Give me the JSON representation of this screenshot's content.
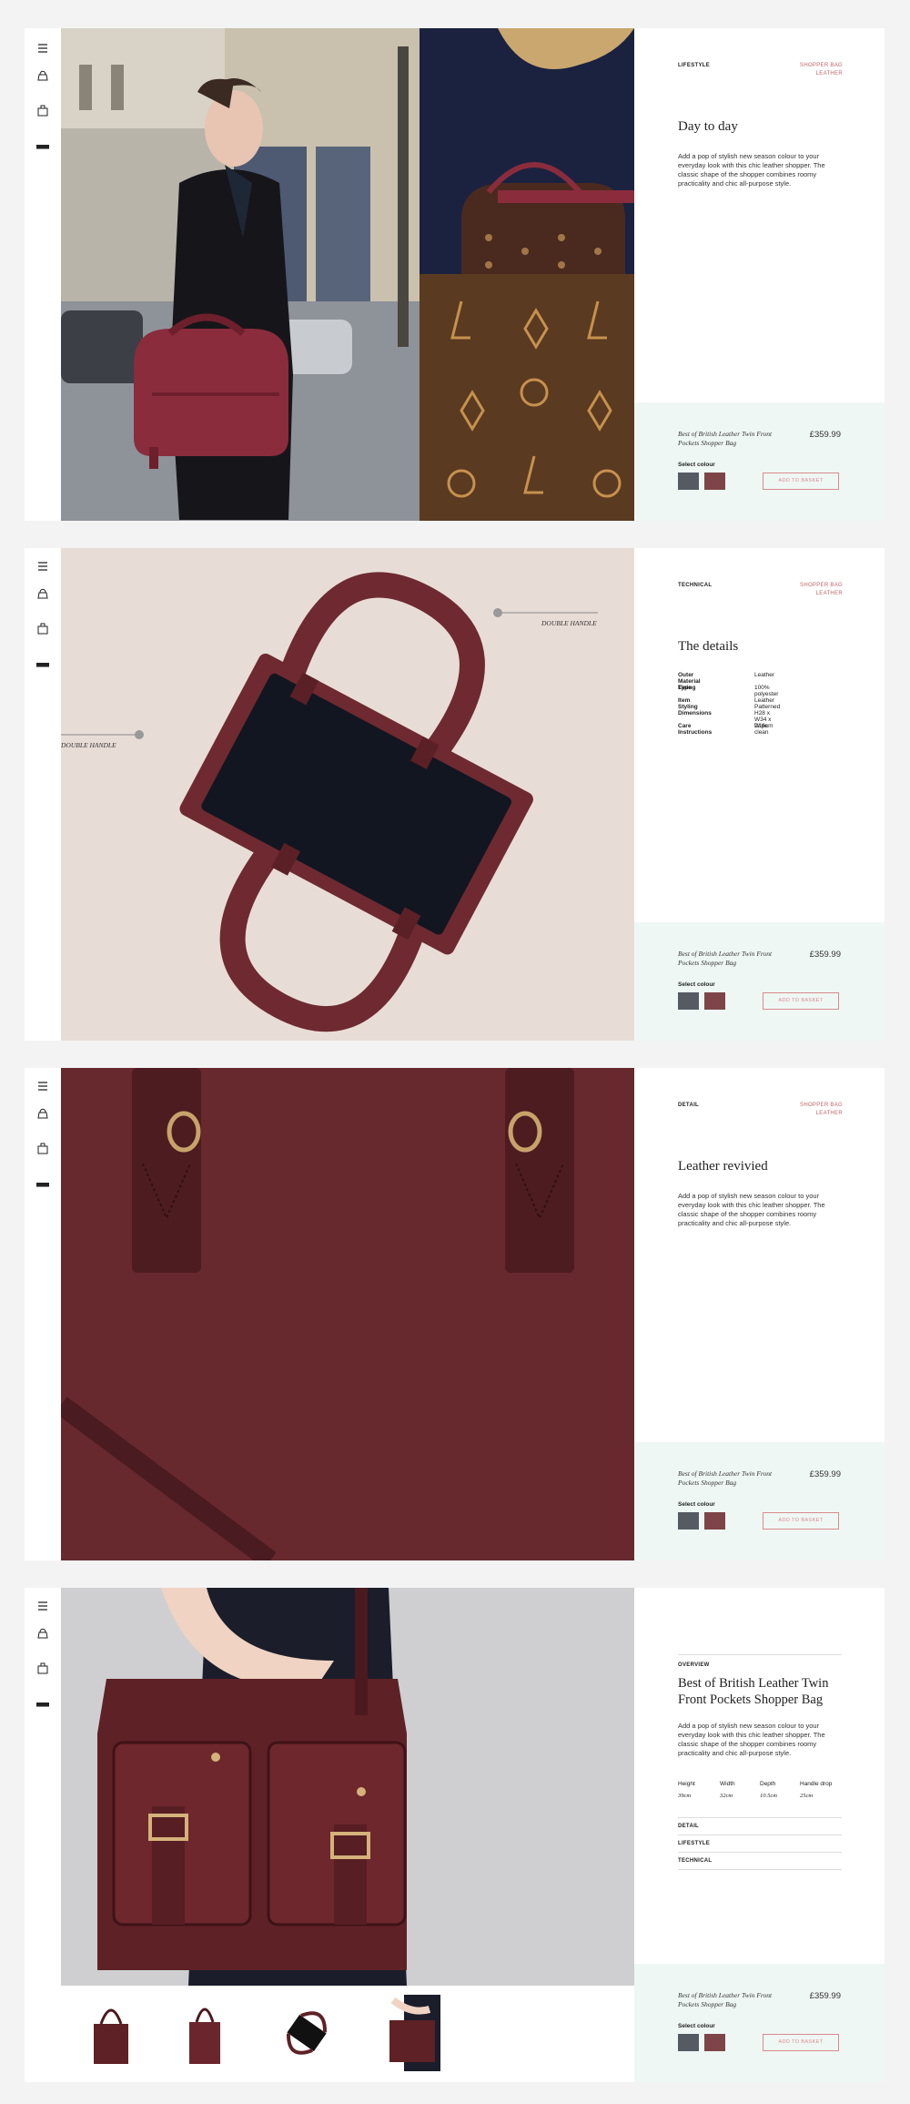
{
  "colors": {
    "accent": "#c0636b",
    "panel": "#eff7f4",
    "swatch_grey": "#565a63",
    "swatch_burgundy": "#7d4548"
  },
  "rail": {
    "icons": [
      "menu-icon",
      "bag-top-icon",
      "bag-shopper-icon",
      "card-icon"
    ]
  },
  "product": {
    "name": "Best of British Leather Twin Front Pockets Shopper Bag",
    "price": "£359.99",
    "select_colour": "Select colour",
    "add_to_basket": "ADD TO BASKET"
  },
  "sections": [
    {
      "category": "LIFESTYLE",
      "tags": [
        "SHOPPER BAG",
        "LEATHER"
      ],
      "title": "Day to day",
      "description": "Add a pop of stylish new season colour to your everyday look with this chic leather shopper. The classic shape of the shopper combines roomy practicality and chic all-purpose style."
    },
    {
      "category": "TECHNICAL",
      "tags": [
        "SHOPPER BAG",
        "LEATHER"
      ],
      "title": "The details",
      "callouts": [
        "DOUBLE HANDLE",
        "DOUBLE HANDLE"
      ],
      "specs": [
        {
          "k": "Outer Material Type",
          "v": "Leather"
        },
        {
          "k": "Lining",
          "v": "100% polyester"
        },
        {
          "k": "Item Styling",
          "v": "Leather Patterned"
        },
        {
          "k": "Dimensions",
          "v": "H28 x W34 x D16cm"
        },
        {
          "k": "Care Instructions",
          "v": "Wipe clean"
        }
      ]
    },
    {
      "category": "DETAIL",
      "tags": [
        "SHOPPER BAG",
        "LEATHER"
      ],
      "title": "Leather revivied",
      "description": "Add a pop of stylish new season colour to your everyday look with this chic leather shopper. The classic shape of the shopper combines roomy practicality and chic all-purpose style."
    },
    {
      "category": "OVERVIEW",
      "title": "Best of British Leather Twin Front Pockets Shopper Bag",
      "description": "Add a pop of stylish new season colour to your everyday look with this chic leather shopper. The classic shape of the shopper combines roomy practicality and chic all-purpose style.",
      "measures": {
        "headers": [
          "Height",
          "Width",
          "Depth",
          "Handle drop"
        ],
        "values": [
          "39cm",
          "32cm",
          "10.5cm",
          "25cm"
        ]
      },
      "links": [
        "DETAIL",
        "LIFESTYLE",
        "TECHNICAL"
      ]
    }
  ]
}
